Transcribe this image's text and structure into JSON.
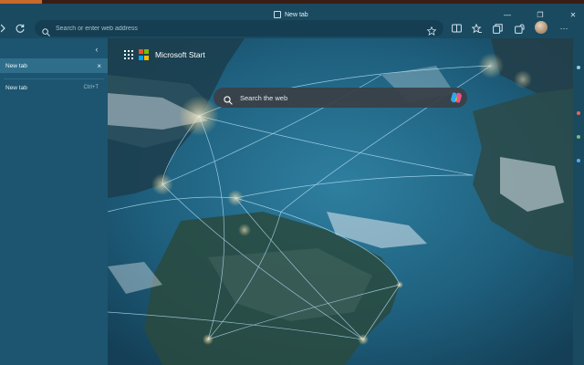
{
  "tab": {
    "title": "New tab",
    "icon": "page-icon"
  },
  "window_controls": {
    "minimize": "—",
    "restore": "❐",
    "close": "✕"
  },
  "toolbar": {
    "address_placeholder": "Search or enter web address",
    "icons": [
      "sidebar-toggle-icon",
      "refresh-icon",
      "search-icon",
      "favorite-star-icon",
      "split-screen-icon",
      "favorites-icon",
      "collections-icon",
      "extensions-icon",
      "profile-avatar",
      "more-icon"
    ]
  },
  "sidebar": {
    "collapse_icon": "‹",
    "active_tab": {
      "label": "New tab",
      "close": "×"
    },
    "new_tab": {
      "label": "New tab",
      "shortcut": "Ctrl+T"
    }
  },
  "page": {
    "brand": "Microsoft Start",
    "search_placeholder": "Search the web",
    "ms_logo_colors": [
      "#f25022",
      "#7fba00",
      "#00a4ef",
      "#ffb900"
    ],
    "accent": "#1b4d63"
  }
}
